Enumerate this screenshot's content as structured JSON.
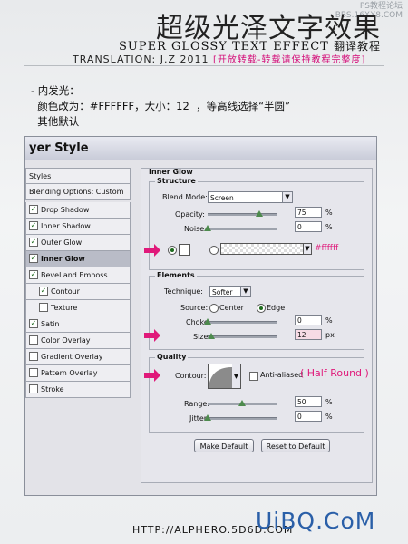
{
  "header": {
    "watermark_top": "PS教程论坛\nBBS.16XX8.COM",
    "title_cn": "超级光泽文字效果",
    "title_en": "SUPER GLOSSY TEXT EFFECT",
    "title_en_suffix": "翻译教程",
    "translation_label": "TRANSLATION: J.Z  2011",
    "translation_note": "[开放转载-转载请保持教程完整度]"
  },
  "instructions": {
    "line1": "- 内发光：",
    "line2": "  颜色改为：#FFFFFF，大小：12  ，等高线选择“半圆”",
    "line3": "  其他默认"
  },
  "dialog": {
    "title": "yer Style",
    "left_list": [
      {
        "label": "Styles",
        "checkbox": false,
        "checked": false,
        "selected": false
      },
      {
        "label": "Blending Options: Custom",
        "checkbox": false,
        "checked": false,
        "selected": false
      },
      {
        "label": "Drop Shadow",
        "checkbox": true,
        "checked": true,
        "selected": false
      },
      {
        "label": "Inner Shadow",
        "checkbox": true,
        "checked": true,
        "selected": false
      },
      {
        "label": "Outer Glow",
        "checkbox": true,
        "checked": true,
        "selected": false
      },
      {
        "label": "Inner Glow",
        "checkbox": true,
        "checked": true,
        "selected": true
      },
      {
        "label": "Bevel and Emboss",
        "checkbox": true,
        "checked": true,
        "selected": false
      },
      {
        "label": "Contour",
        "checkbox": true,
        "checked": true,
        "selected": false
      },
      {
        "label": "Texture",
        "checkbox": true,
        "checked": false,
        "selected": false
      },
      {
        "label": "Satin",
        "checkbox": true,
        "checked": true,
        "selected": false
      },
      {
        "label": "Color Overlay",
        "checkbox": true,
        "checked": false,
        "selected": false
      },
      {
        "label": "Gradient Overlay",
        "checkbox": true,
        "checked": false,
        "selected": false
      },
      {
        "label": "Pattern Overlay",
        "checkbox": true,
        "checked": false,
        "selected": false
      },
      {
        "label": "Stroke",
        "checkbox": true,
        "checked": false,
        "selected": false
      }
    ],
    "inner_glow": {
      "section_title": "Inner Glow",
      "structure": {
        "title": "Structure",
        "blend_mode_label": "Blend Mode:",
        "blend_mode_value": "Screen",
        "opacity_label": "Opacity:",
        "opacity_value": "75",
        "opacity_level": 0.75,
        "noise_label": "Noise:",
        "noise_value": "0",
        "noise_level": 0,
        "percent": "%",
        "color_annotation": "#ffffff"
      },
      "elements": {
        "title": "Elements",
        "technique_label": "Technique:",
        "technique_value": "Softer",
        "source_label": "Source:",
        "source_center": "Center",
        "source_edge": "Edge",
        "choke_label": "Choke:",
        "choke_value": "0",
        "choke_level": 0,
        "size_label": "Size:",
        "size_value": "12",
        "size_unit": "px",
        "size_level": 0.05
      },
      "quality": {
        "title": "Quality",
        "contour_label": "Contour:",
        "anti_aliased_label": "Anti-aliased",
        "contour_annotation": "( Half Round )",
        "range_label": "Range:",
        "range_value": "50",
        "range_level": 0.5,
        "jitter_label": "Jitter:",
        "jitter_value": "0",
        "jitter_level": 0
      },
      "make_default": "Make Default",
      "reset_default": "Reset to Default"
    }
  },
  "footer": {
    "url": "HTTP://ALPHERO.5D6D.COM",
    "logo": "UiBQ.CoM"
  },
  "colors": {
    "accent_pink": "#e0197a",
    "logo_blue": "#2a5fa8"
  }
}
